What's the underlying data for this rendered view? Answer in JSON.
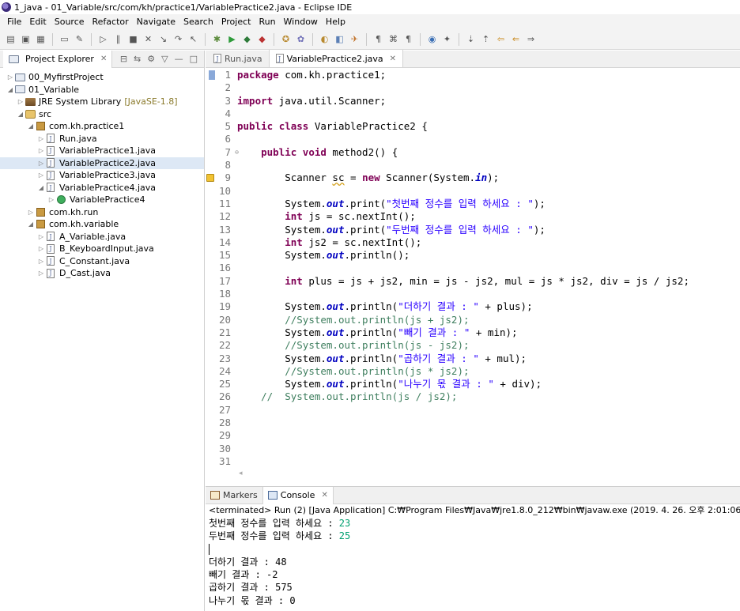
{
  "window": {
    "title": "1_java - 01_Variable/src/com/kh/practice1/VariablePractice2.java - Eclipse IDE"
  },
  "menu": [
    "File",
    "Edit",
    "Source",
    "Refactor",
    "Navigate",
    "Search",
    "Project",
    "Run",
    "Window",
    "Help"
  ],
  "project_explorer": {
    "title": "Project Explorer",
    "tree": [
      {
        "label": "00_MyfirstProject",
        "icon": "project-icon",
        "depth": 0,
        "twisty": "▷"
      },
      {
        "label": "01_Variable",
        "icon": "project-icon",
        "depth": 0,
        "twisty": "◢"
      },
      {
        "label": "JRE System Library",
        "decoration": "[JavaSE-1.8]",
        "icon": "jre-library-icon",
        "depth": 1,
        "twisty": "▷"
      },
      {
        "label": "src",
        "icon": "source-folder-icon",
        "depth": 1,
        "twisty": "◢"
      },
      {
        "label": "com.kh.practice1",
        "icon": "package-icon",
        "depth": 2,
        "twisty": "◢"
      },
      {
        "label": "Run.java",
        "icon": "java-file-icon",
        "depth": 3,
        "twisty": "▷"
      },
      {
        "label": "VariablePractice1.java",
        "icon": "java-file-icon",
        "depth": 3,
        "twisty": "▷"
      },
      {
        "label": "VariablePractice2.java",
        "icon": "java-file-icon",
        "depth": 3,
        "twisty": "▷",
        "selected": true
      },
      {
        "label": "VariablePractice3.java",
        "icon": "java-file-icon",
        "depth": 3,
        "twisty": "▷"
      },
      {
        "label": "VariablePractice4.java",
        "icon": "java-file-icon",
        "depth": 3,
        "twisty": "◢"
      },
      {
        "label": "VariablePractice4",
        "icon": "class-icon",
        "depth": 4,
        "twisty": "▷"
      },
      {
        "label": "com.kh.run",
        "icon": "package-icon",
        "depth": 2,
        "twisty": "▷"
      },
      {
        "label": "com.kh.variable",
        "icon": "package-icon",
        "depth": 2,
        "twisty": "◢"
      },
      {
        "label": "A_Variable.java",
        "icon": "java-file-icon",
        "depth": 3,
        "twisty": "▷"
      },
      {
        "label": "B_KeyboardInput.java",
        "icon": "java-file-icon",
        "depth": 3,
        "twisty": "▷"
      },
      {
        "label": "C_Constant.java",
        "icon": "java-file-icon",
        "depth": 3,
        "twisty": "▷"
      },
      {
        "label": "D_Cast.java",
        "icon": "java-file-icon",
        "depth": 3,
        "twisty": "▷"
      }
    ]
  },
  "editor": {
    "tabs": [
      {
        "label": "Run.java",
        "active": false
      },
      {
        "label": "VariablePractice2.java",
        "active": true
      }
    ],
    "lines": [
      {
        "n": "1",
        "html": "<span class=\"kw\">package</span> com.kh.practice1;"
      },
      {
        "n": "2",
        "html": ""
      },
      {
        "n": "3",
        "html": "<span class=\"kw\">import</span> java.util.Scanner;"
      },
      {
        "n": "4",
        "html": ""
      },
      {
        "n": "5",
        "html": "<span class=\"kw\">public</span> <span class=\"kw\">class</span> VariablePractice2 {"
      },
      {
        "n": "6",
        "html": ""
      },
      {
        "n": "7",
        "html": "    <span class=\"kw\">public</span> <span class=\"kw\">void</span> method2() {"
      },
      {
        "n": "8",
        "html": ""
      },
      {
        "n": "9",
        "html": "        Scanner <span class=\"warnu\">sc</span> = <span class=\"kw\">new</span> Scanner(System.<span class=\"fld\">in</span>);"
      },
      {
        "n": "10",
        "html": ""
      },
      {
        "n": "11",
        "html": "        System.<span class=\"fld\">out</span>.print(<span class=\"str\">\"첫번째 정수를 입력 하세요 : \"</span>);"
      },
      {
        "n": "12",
        "html": "        <span class=\"kw\">int</span> js = sc.nextInt();"
      },
      {
        "n": "13",
        "html": "        System.<span class=\"fld\">out</span>.print(<span class=\"str\">\"두번째 정수를 입력 하세요 : \"</span>);"
      },
      {
        "n": "14",
        "html": "        <span class=\"kw\">int</span> js2 = sc.nextInt();"
      },
      {
        "n": "15",
        "html": "        System.<span class=\"fld\">out</span>.println();"
      },
      {
        "n": "16",
        "html": ""
      },
      {
        "n": "17",
        "html": "        <span class=\"kw\">int</span> plus = js + js2, min = js - js2, mul = js * js2, div = js / js2;"
      },
      {
        "n": "18",
        "html": ""
      },
      {
        "n": "19",
        "html": "        System.<span class=\"fld\">out</span>.println(<span class=\"str\">\"더하기 결과 : \"</span> + plus);"
      },
      {
        "n": "20",
        "html": "        <span class=\"com\">//System.out.println(js + js2);</span>"
      },
      {
        "n": "21",
        "html": "        System.<span class=\"fld\">out</span>.println(<span class=\"str\">\"빼기 결과 : \"</span> + min);"
      },
      {
        "n": "22",
        "html": "        <span class=\"com\">//System.out.println(js - js2);</span>"
      },
      {
        "n": "23",
        "html": "        System.<span class=\"fld\">out</span>.println(<span class=\"str\">\"곱하기 결과 : \"</span> + mul);"
      },
      {
        "n": "24",
        "html": "        <span class=\"com\">//System.out.println(js * js2);</span>"
      },
      {
        "n": "25",
        "html": "        System.<span class=\"fld\">out</span>.println(<span class=\"str\">\"나누기 몫 결과 : \"</span> + div);"
      },
      {
        "n": "26",
        "html": "    <span class=\"com\">//  System.out.println(js / js2);</span>"
      },
      {
        "n": "27",
        "html": ""
      },
      {
        "n": "28",
        "html": ""
      },
      {
        "n": "29",
        "html": ""
      },
      {
        "n": "30",
        "html": ""
      },
      {
        "n": "31",
        "html": ""
      }
    ]
  },
  "bottom_panel": {
    "tabs": [
      {
        "label": "Markers",
        "active": false
      },
      {
        "label": "Console",
        "active": true
      }
    ],
    "status": "<terminated> Run (2) [Java Application] C:₩Program Files₩Java₩jre1.8.0_212₩bin₩javaw.exe (2019. 4. 26. 오후 2:01:06)",
    "output": [
      {
        "text": "첫번째 정수를 입력 하세요 : ",
        "input": "23"
      },
      {
        "text": "두번째 정수를 입력 하세요 : ",
        "input": "25"
      },
      {
        "text": "",
        "input": "",
        "caret": true
      },
      {
        "text": "더하기 결과 : 48",
        "input": ""
      },
      {
        "text": "빼기 결과 : -2",
        "input": ""
      },
      {
        "text": "곱하기 결과 : 575",
        "input": ""
      },
      {
        "text": "나누기 몫 결과 : 0",
        "input": ""
      }
    ]
  }
}
